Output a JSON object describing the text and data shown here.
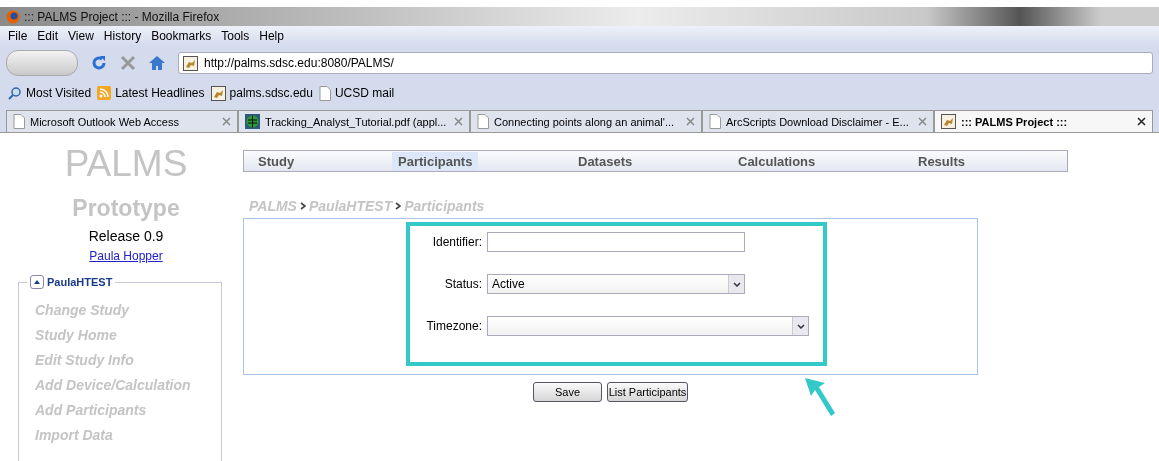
{
  "window": {
    "title": "::: PALMS Project ::: - Mozilla Firefox"
  },
  "menu": [
    "File",
    "Edit",
    "View",
    "History",
    "Bookmarks",
    "Tools",
    "Help"
  ],
  "address": {
    "value": "http://palms.sdsc.edu:8080/PALMS/"
  },
  "bookmarks": [
    {
      "kind": "search",
      "label": "Most Visited"
    },
    {
      "kind": "feed",
      "label": "Latest Headlines"
    },
    {
      "kind": "site",
      "label": "palms.sdsc.edu"
    },
    {
      "kind": "page",
      "label": "UCSD mail"
    }
  ],
  "tabs": [
    {
      "kind": "page",
      "label": "Microsoft Outlook Web Access",
      "selected": false
    },
    {
      "kind": "globe",
      "label": "Tracking_Analyst_Tutorial.pdf (appl...",
      "selected": false
    },
    {
      "kind": "page",
      "label": "Connecting points along an animal'...",
      "selected": false
    },
    {
      "kind": "page",
      "label": "ArcScripts Download Disclaimer - E...",
      "selected": false
    },
    {
      "kind": "site",
      "label": "::: PALMS Project :::",
      "selected": true
    }
  ],
  "sidebar": {
    "logo": "PALMS",
    "subtitle": "Prototype",
    "release": "Release 0.9",
    "user": "Paula Hopper",
    "study": "PaulaHTEST",
    "items": [
      "Change Study",
      "Study Home",
      "Edit Study Info",
      "Add Device/Calculation",
      "Add Participants",
      "Import Data"
    ]
  },
  "nav": [
    {
      "label": "Study",
      "selected": false
    },
    {
      "label": "Participants",
      "selected": true
    },
    {
      "label": "Datasets",
      "selected": false
    },
    {
      "label": "Calculations",
      "selected": false
    },
    {
      "label": "Results",
      "selected": false
    }
  ],
  "breadcrumb": [
    "PALMS",
    "PaulaHTEST",
    "Participants"
  ],
  "form": [
    {
      "kind": "text",
      "label": "Identifier:"
    },
    {
      "kind": "select",
      "label": "Status:",
      "value": "Active"
    },
    {
      "kind": "select",
      "label": "Timezone:"
    }
  ],
  "buttons": [
    "Save",
    "List Participants"
  ]
}
